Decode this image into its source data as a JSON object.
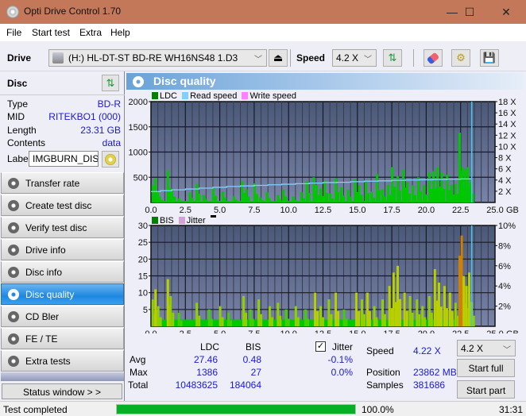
{
  "window": {
    "title": "Opti Drive Control 1.70",
    "controls": {
      "minimize": "—",
      "maximize": "☐",
      "close": "✕"
    }
  },
  "menu": [
    "File",
    "Start test",
    "Extra",
    "Help"
  ],
  "toolbar": {
    "drive_label": "Drive",
    "drive_value": "(H:)  HL-DT-ST BD-RE  WH16NS48 1.D3",
    "speed_label": "Speed",
    "speed_value": "4.2 X",
    "icons": [
      "eject-icon",
      "refresh-icon",
      "erase-icon",
      "settings-icon",
      "save-icon"
    ]
  },
  "disc": {
    "header": "Disc",
    "rows": [
      {
        "key": "Type",
        "value": "BD-R"
      },
      {
        "key": "MID",
        "value": "RITEKBO1 (000)"
      },
      {
        "key": "Length",
        "value": "23.31 GB"
      },
      {
        "key": "Contents",
        "value": "data"
      }
    ],
    "label_key": "Label",
    "label_value": "IMGBURN_DIS"
  },
  "nav": [
    {
      "label": "Transfer rate",
      "active": false
    },
    {
      "label": "Create test disc",
      "active": false
    },
    {
      "label": "Verify test disc",
      "active": false
    },
    {
      "label": "Drive info",
      "active": false
    },
    {
      "label": "Disc info",
      "active": false
    },
    {
      "label": "Disc quality",
      "active": true
    },
    {
      "label": "CD Bler",
      "active": false
    },
    {
      "label": "FE / TE",
      "active": false
    },
    {
      "label": "Extra tests",
      "active": false
    }
  ],
  "status_window_label": "Status window > >",
  "panel_title": "Disc quality",
  "colors": {
    "ldc": "#00c800",
    "read_speed": "#80d0ff",
    "write_speed": "#ff80ff",
    "bis": "#008000",
    "jitter": "#d8a0d8",
    "plot_bg_top": "#4a5878",
    "plot_bg_bottom": "#7884a8",
    "accent": "#1e88e0"
  },
  "chart_data": [
    {
      "type": "bar",
      "title": "LDC / Read speed",
      "legend": [
        "LDC",
        "Read speed",
        "Write speed"
      ],
      "legend_placement": "top-left",
      "xlabel": "GB",
      "x_ticks": [
        "0.0",
        "2.5",
        "5.0",
        "7.5",
        "10.0",
        "12.5",
        "15.0",
        "17.5",
        "20.0",
        "22.5",
        "25.0"
      ],
      "xlim": [
        0,
        25
      ],
      "ylim": [
        0,
        2000
      ],
      "y_ticks": [
        "500",
        "1000",
        "1500",
        "2000"
      ],
      "y2_ticks": [
        "2 X",
        "4 X",
        "6 X",
        "8 X",
        "10 X",
        "12 X",
        "14 X",
        "16 X",
        "18 X"
      ],
      "y2lim": [
        0,
        18
      ],
      "grid": true,
      "end_marker_gb": 23.31,
      "ldc_series": {
        "x": [
          0.1,
          0.3,
          0.6,
          1.2,
          1.5,
          2.0,
          2.8,
          3.3,
          3.8,
          4.5,
          5.2,
          6.0,
          6.6,
          6.9,
          7.5,
          7.9,
          8.4,
          9.2,
          9.6,
          10.3,
          10.9,
          11.3,
          11.8,
          12.0,
          12.3,
          12.6,
          13.0,
          13.4,
          13.8,
          14.3,
          14.8,
          15.1,
          15.6,
          16.0,
          16.4,
          16.8,
          17.2,
          17.5,
          17.9,
          18.3,
          18.6,
          19.0,
          19.4,
          19.8,
          20.2,
          20.5,
          20.8,
          21.1,
          21.5,
          21.8,
          22.1,
          22.4,
          22.6,
          22.8,
          23.0,
          23.2
        ],
        "values": [
          350,
          480,
          120,
          640,
          250,
          80,
          200,
          380,
          150,
          300,
          220,
          120,
          420,
          260,
          380,
          100,
          200,
          150,
          260,
          120,
          200,
          420,
          500,
          350,
          280,
          420,
          180,
          480,
          300,
          260,
          460,
          350,
          420,
          220,
          560,
          260,
          350,
          700,
          520,
          650,
          400,
          340,
          500,
          350,
          600,
          620,
          700,
          600,
          550,
          350,
          380,
          1386,
          700,
          650,
          700,
          400
        ]
      },
      "read_speed_series": {
        "x": [
          0.0,
          0.7,
          1.5,
          2.5,
          3.5,
          4.5,
          5.5,
          6.5,
          7.5,
          8.5,
          9.5,
          10.5,
          11.5,
          12.5,
          13.5,
          14.5,
          15.5,
          16.5,
          17.5,
          18.5,
          19.5,
          20.5,
          21.5,
          22.5,
          23.3
        ],
        "values": [
          1.95,
          2.1,
          2.25,
          2.4,
          2.55,
          2.7,
          2.85,
          2.95,
          3.05,
          3.15,
          3.25,
          3.35,
          3.45,
          3.55,
          3.6,
          3.7,
          3.8,
          3.85,
          3.95,
          4.0,
          4.05,
          4.1,
          4.15,
          4.2,
          4.22
        ]
      }
    },
    {
      "type": "bar",
      "title": "BIS / Jitter",
      "legend": [
        "BIS",
        "Jitter"
      ],
      "legend_placement": "top-left",
      "xlabel": "GB",
      "x_ticks": [
        "0.0",
        "2.5",
        "5.0",
        "7.5",
        "10.0",
        "12.5",
        "15.0",
        "17.5",
        "20.0",
        "22.5",
        "25.0"
      ],
      "xlim": [
        0,
        25
      ],
      "ylim": [
        0,
        30
      ],
      "y_ticks": [
        "5",
        "10",
        "15",
        "20",
        "25",
        "30"
      ],
      "y2_ticks": [
        "2%",
        "4%",
        "6%",
        "8%",
        "10%"
      ],
      "y2lim": [
        0,
        10
      ],
      "grid": true,
      "end_marker_gb": 23.31,
      "bis_series": {
        "x": [
          0.1,
          0.3,
          0.5,
          1.2,
          1.4,
          2.0,
          3.3,
          4.2,
          5.0,
          5.6,
          6.7,
          7.2,
          7.8,
          8.6,
          9.2,
          9.8,
          10.5,
          11.2,
          11.9,
          12.3,
          12.9,
          13.4,
          14.0,
          14.9,
          15.3,
          15.7,
          16.2,
          16.8,
          17.3,
          17.6,
          17.9,
          18.4,
          18.8,
          19.3,
          19.7,
          20.2,
          20.6,
          20.9,
          21.3,
          21.7,
          22.1,
          22.4,
          22.55,
          22.7,
          22.9,
          23.1,
          23.25
        ],
        "values": [
          8,
          11,
          6,
          14,
          9,
          4,
          7,
          5,
          6,
          4,
          9,
          5,
          8,
          6,
          7,
          5,
          6,
          5,
          10,
          6,
          8,
          10,
          5,
          10,
          8,
          10,
          6,
          8,
          12,
          16,
          18,
          10,
          9,
          8,
          6,
          9,
          17,
          13,
          12,
          10,
          7,
          21,
          27,
          15,
          12,
          16,
          7
        ]
      }
    }
  ],
  "stats": {
    "col_ldc": "LDC",
    "col_bis": "BIS",
    "rows": [
      {
        "label": "Avg",
        "ldc": "27.46",
        "bis": "0.48",
        "jitter": "-0.1%"
      },
      {
        "label": "Max",
        "ldc": "1386",
        "bis": "27",
        "jitter": "0.0%"
      },
      {
        "label": "Total",
        "ldc": "10483625",
        "bis": "184064",
        "jitter": ""
      }
    ],
    "jitter_label": "Jitter",
    "jitter_checked": true
  },
  "run": {
    "speed_label": "Speed",
    "speed_value": "4.22 X",
    "position_label": "Position",
    "position_value": "23862 MB",
    "samples_label": "Samples",
    "samples_value": "381686",
    "speed_select": "4.2 X",
    "start_full": "Start full",
    "start_part": "Start part"
  },
  "statusbar": {
    "text": "Test completed",
    "progress": 100.0,
    "progress_text": "100.0%",
    "time": "31:31"
  }
}
